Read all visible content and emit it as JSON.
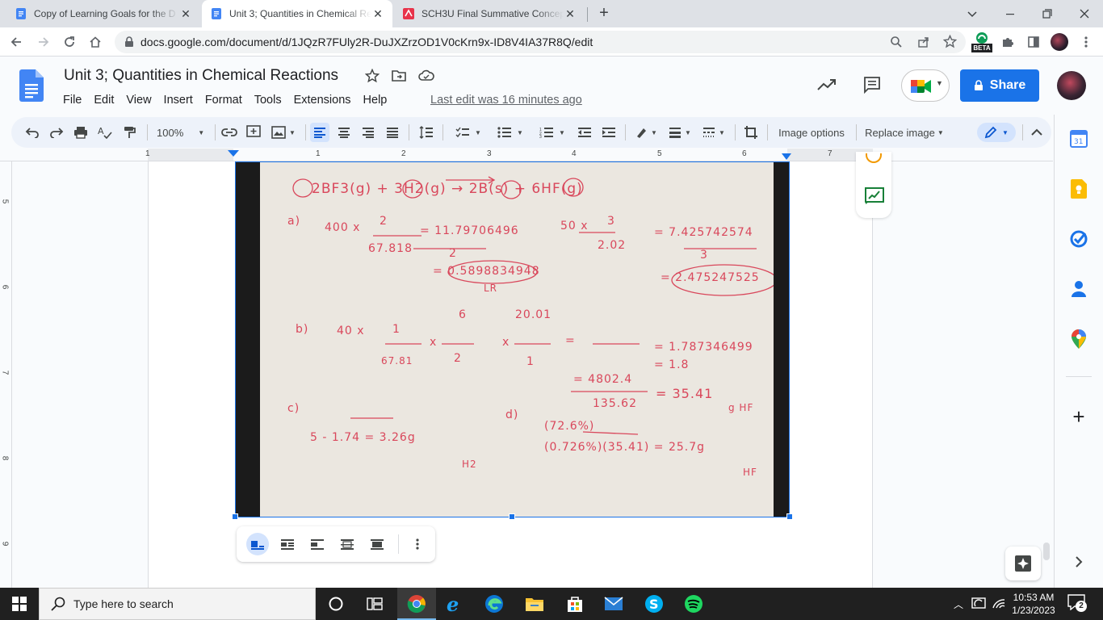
{
  "browser": {
    "tabs": [
      {
        "title": "Copy of Learning Goals for the D",
        "icon": "google-docs-icon",
        "active": false
      },
      {
        "title": "Unit 3; Quantities in Chemical Re",
        "icon": "google-docs-icon",
        "active": true
      },
      {
        "title": "SCH3U Final Summative Concept",
        "icon": "assignment-icon",
        "active": false
      }
    ],
    "url": "docs.google.com/document/d/1JQzR7FUly2R-DuJXZrzOD1V0cKrn9x-ID8V4IA37R8Q/edit",
    "beta_label": "BETA"
  },
  "doc": {
    "title": "Unit 3; Quantities in Chemical Reactions",
    "menu": [
      "File",
      "Edit",
      "View",
      "Insert",
      "Format",
      "Tools",
      "Extensions",
      "Help"
    ],
    "last_edit": "Last edit was 16 minutes ago",
    "share_label": "Share"
  },
  "toolbar": {
    "zoom": "100%",
    "image_options": "Image options",
    "replace_image": "Replace image"
  },
  "ruler": {
    "h_numbers": [
      "1",
      "1",
      "2",
      "3",
      "4",
      "5",
      "6",
      "7"
    ],
    "v_numbers": [
      "5",
      "6",
      "7",
      "8",
      "9"
    ]
  },
  "handwriting": {
    "header": "2BF3(g) + 3H2(g) → 2B(s) + 6HF(g)",
    "a_label": "a)",
    "a1": "400 x",
    "a1_num": "2",
    "a1_den": "67.818",
    "a1_res": "= 11.79706496",
    "a1_div": "2",
    "a1_final": "= 0.5898834948",
    "a1_lr": "LR",
    "a2": "50 x",
    "a2_num": "3",
    "a2_den": "2.02",
    "a2_res": "= 7.425742574",
    "a2_div": "3",
    "a2_final": "= 2.475247525",
    "b_label": "b)",
    "b1": "40 x",
    "b1_num": "1",
    "b1_den": "67.81",
    "b_x": "x",
    "b2_num": "6",
    "b2_den": "2",
    "b3_num": "20.01",
    "b3_den": "1",
    "b_eq": "=",
    "b_res1": "= 1.787346499",
    "b_res2": "= 1.8",
    "b_frac_num": "= 4802.4",
    "b_frac_den": "135.62",
    "b_res3": "= 35.41",
    "b_unit": "g HF",
    "c_label": "c)",
    "c_line": "5 - 1.74 = 3.26g",
    "c_unit": "H2",
    "d_label": "d)",
    "d_line1": "(72.6%)",
    "d_line2": "(0.726%)(35.41) = 25.7g",
    "d_unit": "HF"
  },
  "taskbar": {
    "search_placeholder": "Type here to search",
    "time": "10:53 AM",
    "date": "1/23/2023",
    "notifications": "2"
  },
  "colors": {
    "accent": "#1a73e8",
    "ink": "#d9475b",
    "paper": "#ebe7e0"
  }
}
